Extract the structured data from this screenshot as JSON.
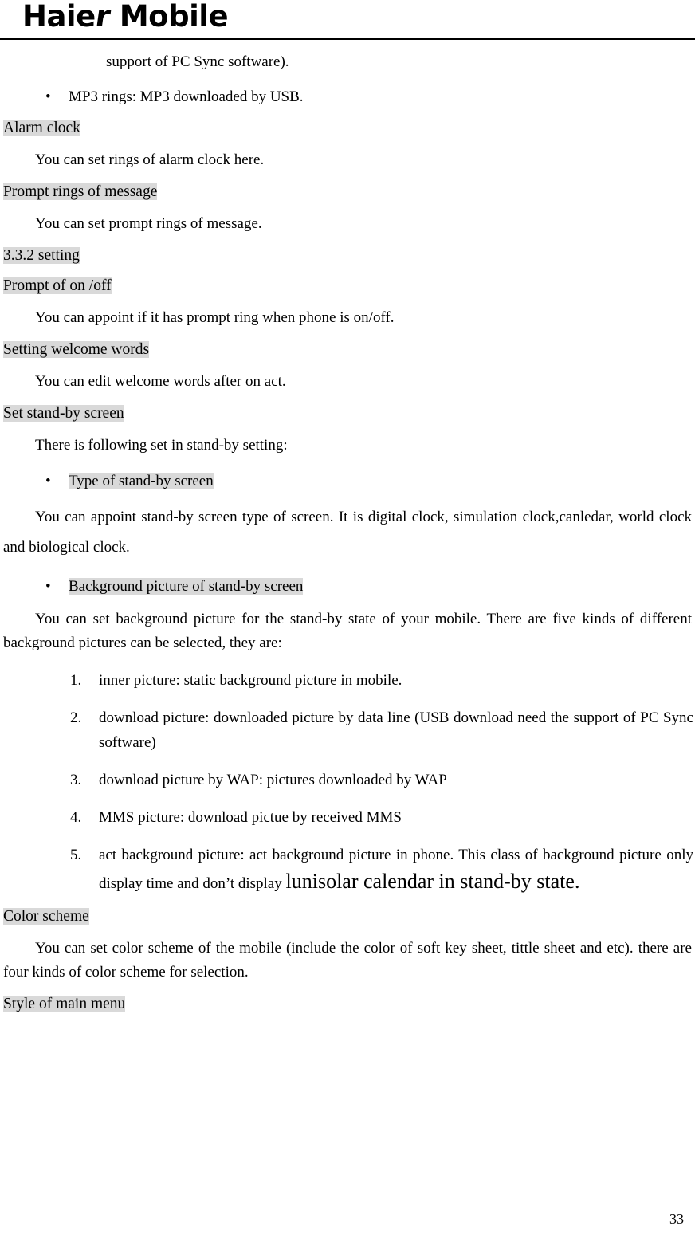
{
  "header": {
    "logo_text": "Haier Mobile",
    "logo_part1": "Haie",
    "logo_swash": "r",
    "logo_part2": " Mobile"
  },
  "colors": {
    "highlight": "#d9d9d9",
    "text": "#000000",
    "background": "#ffffff"
  },
  "body": {
    "continuation_line": "support of PC Sync software).",
    "mp3_bullet": {
      "marker": "•",
      "text": "MP3 rings: MP3 downloaded by USB."
    },
    "alarm_clock": {
      "heading": "Alarm clock",
      "paragraph_text": "You can set rings of alarm clock here.",
      "paragraph_trailing_space": " "
    },
    "prompt_rings": {
      "heading": "Prompt rings of message",
      "paragraph": "You can set prompt rings of message."
    },
    "section_setting": {
      "heading": "3.3.2 setting"
    },
    "prompt_on_off": {
      "heading": "Prompt of on /off",
      "heading_trailing_space": "  ",
      "paragraph": "You can appoint if it has prompt ring when phone is on/off."
    },
    "welcome_words": {
      "heading": "Setting welcome words",
      "heading_trailing_space": "  ",
      "paragraph": "You can edit welcome words after on act."
    },
    "standby_screen": {
      "heading": "Set stand-by screen",
      "paragraph": "There is following set in stand-by setting:",
      "bullet_type": {
        "marker": "•",
        "label": "Type of stand-by screen",
        "paragraph": "You can appoint stand-by screen type of screen. It is digital clock, simulation clock,canledar, world clock and biological clock."
      },
      "bullet_background": {
        "marker": "•",
        "label": "Background picture of stand-by screen",
        "label_trailing_space": "  ",
        "paragraph": "You can set background picture for the stand-by state of your mobile. There are five kinds of different background pictures can be selected, they are:"
      },
      "numbered_items": [
        {
          "number": "1.",
          "text": "inner picture: static background picture in mobile."
        },
        {
          "number": "2.",
          "text": "download picture: downloaded picture by data line (USB download need the support of PC Sync software)"
        },
        {
          "number": "3.",
          "text": "download picture by WAP: pictures downloaded by WAP"
        },
        {
          "number": "4.",
          "text": "MMS picture: download pictue by received MMS"
        },
        {
          "number": "5.",
          "text_small": "act background picture: act background picture in phone. This class of background picture only display time and don’t display ",
          "text_large": "lunisolar calendar in stand-by state."
        }
      ]
    },
    "color_scheme": {
      "heading": "Color scheme",
      "paragraph": "You can set color scheme of the mobile (include the color of soft key sheet, tittle sheet and etc). there are four kinds of color scheme for selection."
    },
    "main_menu_style": {
      "heading": "Style of main menu",
      "heading_trailing_space": "  "
    }
  },
  "footer": {
    "page_number": "33"
  }
}
